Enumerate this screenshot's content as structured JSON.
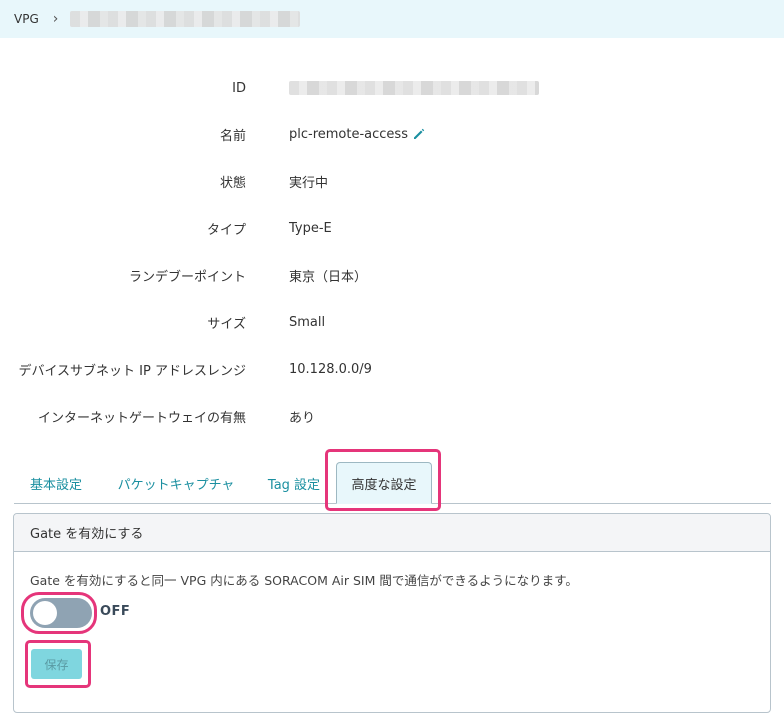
{
  "breadcrumb": {
    "root": "VPG",
    "separator": "›"
  },
  "properties": {
    "id_label": "ID",
    "name_label": "名前",
    "name_value": "plc-remote-access",
    "status_label": "状態",
    "status_value": "実行中",
    "type_label": "タイプ",
    "type_value": "Type-E",
    "rendezvous_label": "ランデブーポイント",
    "rendezvous_value": "東京（日本）",
    "size_label": "サイズ",
    "size_value": "Small",
    "subnet_label": "デバイスサブネット IP アドレスレンジ",
    "subnet_value": "10.128.0.0/9",
    "internet_gateway_label": "インターネットゲートウェイの有無",
    "internet_gateway_value": "あり"
  },
  "tabs": [
    {
      "label": "基本設定",
      "active": false
    },
    {
      "label": "パケットキャプチャ",
      "active": false
    },
    {
      "label": "Tag 設定",
      "active": false
    },
    {
      "label": "高度な設定",
      "active": true
    }
  ],
  "gate_panel": {
    "header": "Gate を有効にする",
    "description": "Gate を有効にすると同一 VPG 内にある SORACOM Air SIM 間で通信ができるようになります。",
    "toggle_state": "OFF",
    "save_label": "保存"
  },
  "colors": {
    "accent": "#1a8fa0",
    "highlight": "#e5357a",
    "breadcrumb_bg": "#e8f7fb",
    "toggle_off": "#8fa3b3",
    "save_button": "#7fd6df"
  },
  "icons": {
    "edit": "pencil-icon",
    "breadcrumb_separator": "chevron-right-icon"
  }
}
